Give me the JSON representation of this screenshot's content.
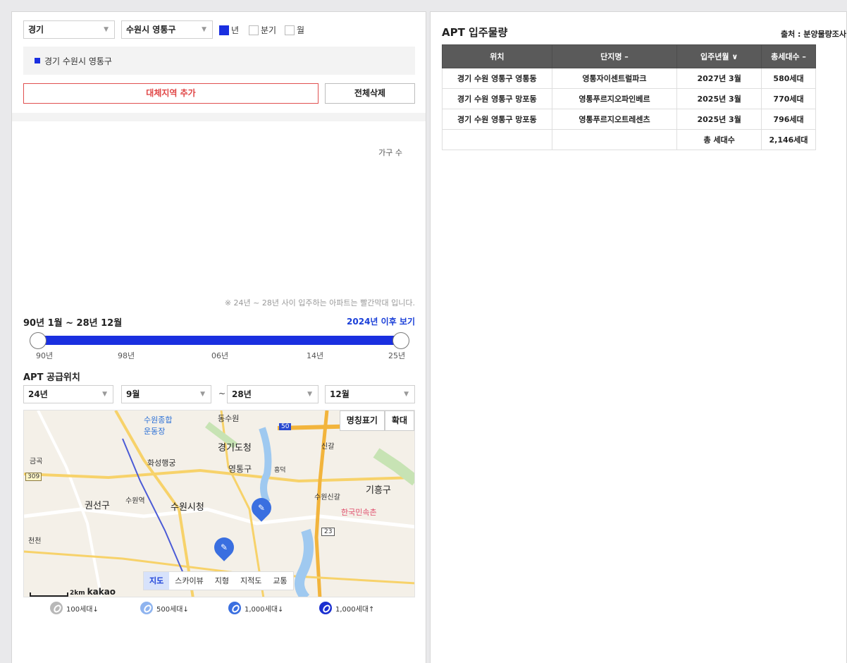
{
  "filters": {
    "province": "경기",
    "district": "수원시 영통구",
    "period_options": [
      {
        "label": "년",
        "checked": true
      },
      {
        "label": "분기",
        "checked": false
      },
      {
        "label": "월",
        "checked": false
      }
    ]
  },
  "selected_region": "경기 수원시 영통구",
  "buttons": {
    "add_region": "대체지역 추가",
    "delete_all": "전체삭제"
  },
  "chart": {
    "ylabel": "가구 수",
    "note": "※ 24년 ~ 28년 사이 입주하는 아파트는 빨간막대 입니다."
  },
  "range": {
    "label": "90년 1월 ~ 28년 12월",
    "link": "2024년 이후 보기",
    "ticks": [
      "90년",
      "98년",
      "06년",
      "14년",
      "25년"
    ],
    "start_fraction": 0.0,
    "end_fraction": 1.0
  },
  "supply": {
    "title": "APT 공급위치",
    "from_year": "24년",
    "from_month": "9월",
    "separator": "~",
    "to_year": "28년",
    "to_month": "12월"
  },
  "map": {
    "buttons": [
      "명칭표기",
      "확대"
    ],
    "types": [
      {
        "label": "지도",
        "active": true
      },
      {
        "label": "스카이뷰",
        "active": false
      },
      {
        "label": "지형",
        "active": false
      },
      {
        "label": "지적도",
        "active": false
      },
      {
        "label": "교통",
        "active": false
      }
    ],
    "scale": "2km",
    "provider": "kakao",
    "labels": {
      "gyeonggi_office": "경기도청",
      "suwon_cityhall": "수원시청",
      "yeongtong": "영통구",
      "gwonseon": "권선구",
      "giheung": "기흥구",
      "suwon_station": "수원역",
      "hwaseong": "화성행궁",
      "stadium": "수원종합\n운동장",
      "folk_village": "한국민속촌",
      "singal": "신갈",
      "suwon_sin_gal": "수원신갈",
      "heungdeok": "흥덕",
      "dongsuwon": "동수원",
      "cheoncheon": "천천",
      "geumgok": "금곡",
      "r309": "309",
      "r23": "23",
      "r50": "50"
    }
  },
  "legend": [
    {
      "label": "100세대↓",
      "color": "#b8b8b8"
    },
    {
      "label": "500세대↓",
      "color": "#8fb4ef"
    },
    {
      "label": "1,000세대↓",
      "color": "#3a6fe0"
    },
    {
      "label": "1,000세대↑",
      "color": "#1a2fd0"
    }
  ],
  "right": {
    "title": "APT 입주물량",
    "source": "출처 : 분양물량조사",
    "headers": [
      "위치",
      "단지명 –",
      "입주년월 ∨",
      "총세대수 –"
    ],
    "rows": [
      [
        "경기 수원 영통구 영통동",
        "영통자이센트럴파크",
        "2027년 3월",
        "580세대"
      ],
      [
        "경기 수원 영통구 망포동",
        "영통푸르지오파인베르",
        "2025년 3월",
        "770세대"
      ],
      [
        "경기 수원 영통구 망포동",
        "영통푸르지오트레센츠",
        "2025년 3월",
        "796세대"
      ]
    ],
    "total_label": "총 세대수",
    "total_value": "2,146세대"
  }
}
